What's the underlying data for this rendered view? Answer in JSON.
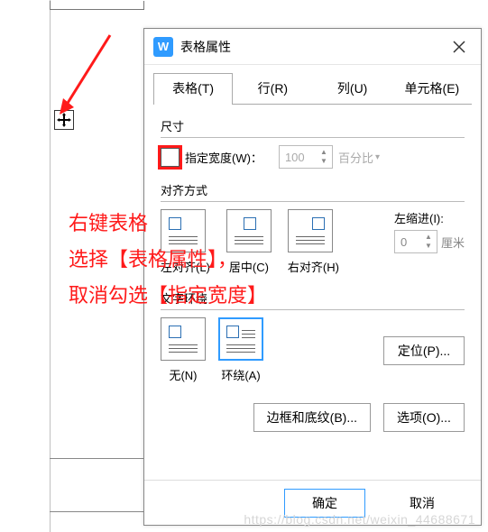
{
  "dialog": {
    "title": "表格属性",
    "tabs": {
      "table": "表格(T)",
      "row": "行(R)",
      "column": "列(U)",
      "cell": "单元格(E)"
    },
    "size": {
      "group": "尺寸",
      "specify_width": "指定宽度(W)：",
      "width_value": "100",
      "unit": "百分比"
    },
    "align": {
      "group": "对齐方式",
      "left": "左对齐(L)",
      "center": "居中(C)",
      "right": "右对齐(H)",
      "indent_label": "左缩进(I):",
      "indent_value": "0",
      "indent_unit": "厘米"
    },
    "wrap": {
      "group": "文字环绕",
      "none": "无(N)",
      "around": "环绕(A)",
      "position_btn": "定位(P)..."
    },
    "buttons": {
      "border": "边框和底纹(B)...",
      "options": "选项(O)...",
      "ok": "确定",
      "cancel": "取消"
    }
  },
  "annotation": {
    "line1": "右键表格",
    "line2": "选择【表格属性】，",
    "line3": "取消勾选【指定宽度】"
  },
  "watermark": "https://blog.csdn.net/weixin_44688671"
}
